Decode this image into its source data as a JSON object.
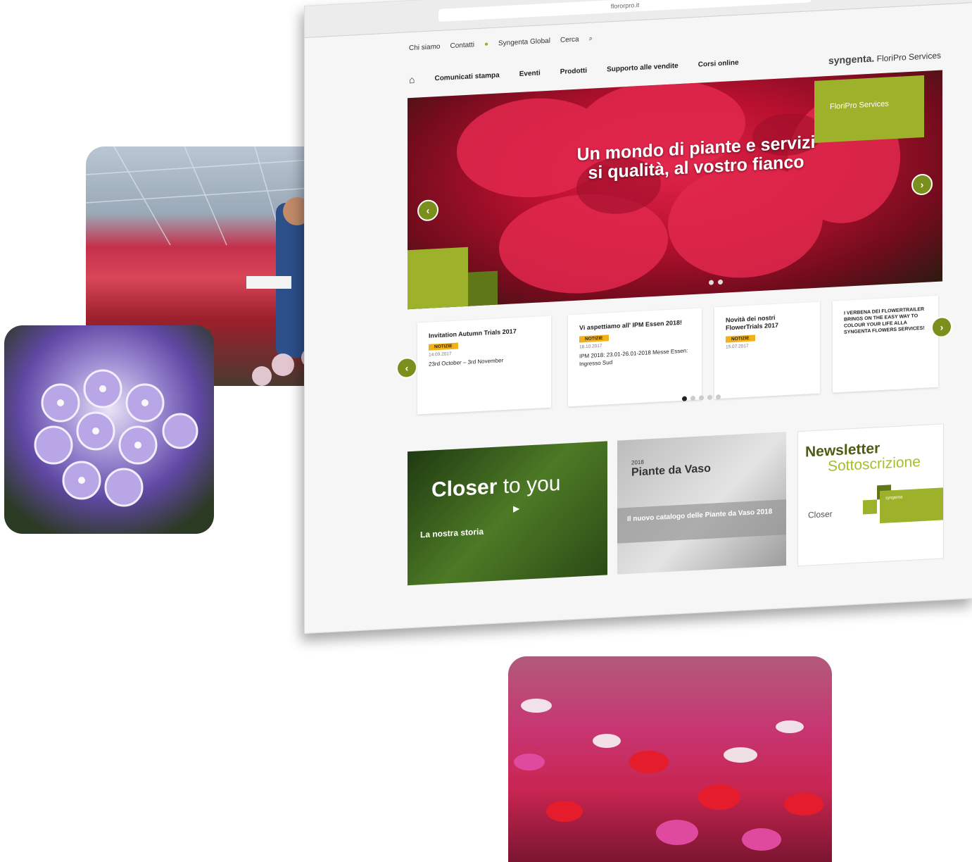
{
  "browser": {
    "url": "flororpro.it"
  },
  "util_nav": {
    "items": [
      "Chi siamo",
      "Contatti",
      "Syngenta Global",
      "Cerca"
    ]
  },
  "main_nav": {
    "items": [
      "Comunicati stampa",
      "Eventi",
      "Prodotti",
      "Supporto alle vendite",
      "Corsi online"
    ]
  },
  "brand": {
    "name": "syngenta.",
    "service": "FloriPro Services"
  },
  "hero": {
    "title": "Un mondo di piante e servizi si qualità, al vostro fianco",
    "badge": "FloriPro Services"
  },
  "news": [
    {
      "title": "Invitation Autumn Trials 2017",
      "tag": "NOTIZIE",
      "date": "14.09.2017",
      "body": "23rd October – 3rd November"
    },
    {
      "title": "Vi aspettiamo all' IPM Essen 2018!",
      "tag": "NOTIZIE",
      "date": "18.10.2017",
      "body": "IPM 2018: 23.01-26.01-2018 Messe Essen: Ingresso Sud"
    },
    {
      "title": "Novità dei nostri FlowerTrials 2017",
      "tag": "NOTIZIE",
      "date": "15.07.2017",
      "body": ""
    },
    {
      "title": "I VERBENA DEI FLOWERTRAILER BRINGS ON THE EASY WAY TO COLOUR YOUR LIFE ALLA SYNGENTA FLOWERS SERVICES!",
      "tag": "",
      "date": "",
      "body": ""
    }
  ],
  "promo_story": {
    "closer": "Closer",
    "to_you": "to you",
    "label": "La nostra storia"
  },
  "promo_catalog": {
    "year": "2018",
    "title": "Piante da Vaso",
    "subtitle": "Il nuovo catalogo delle Piante da Vaso 2018"
  },
  "promo_newsletter": {
    "title": "Newsletter",
    "subtitle": "Sottoscrizione",
    "closer": "Closer",
    "brand": "syngenta"
  },
  "colors": {
    "accent": "#9db22a",
    "accent_dark": "#5f7718",
    "tag": "#f2b019",
    "hero": "#c41535"
  },
  "icons": {
    "home": "home-icon",
    "search": "search-icon",
    "prev": "chevron-left-icon",
    "next": "chevron-right-icon",
    "play": "play-icon"
  }
}
